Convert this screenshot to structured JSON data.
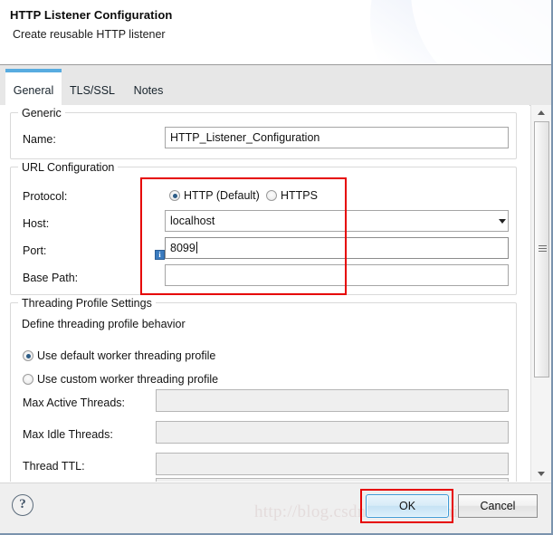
{
  "header": {
    "title": "HTTP Listener Configuration",
    "subtitle": "Create reusable HTTP listener"
  },
  "tabs": [
    {
      "label": "General",
      "active": true
    },
    {
      "label": "TLS/SSL",
      "active": false
    },
    {
      "label": "Notes",
      "active": false
    }
  ],
  "generic_group": {
    "legend": "Generic",
    "name_label": "Name:",
    "name_value": "HTTP_Listener_Configuration"
  },
  "url_group": {
    "legend": "URL Configuration",
    "protocol_label": "Protocol:",
    "protocol_options": [
      {
        "label": "HTTP (Default)",
        "selected": true
      },
      {
        "label": "HTTPS",
        "selected": false
      }
    ],
    "host_label": "Host:",
    "host_value": "localhost",
    "port_label": "Port:",
    "port_value": "8099",
    "port_info_icon": "info-icon",
    "base_path_label": "Base Path:",
    "base_path_value": ""
  },
  "threading_group": {
    "legend": "Threading Profile Settings",
    "description": "Define threading profile behavior",
    "profile_options": [
      {
        "label": "Use default worker threading profile",
        "selected": true
      },
      {
        "label": "Use custom worker threading profile",
        "selected": false
      }
    ],
    "fields": [
      {
        "label": "Max Active Threads:",
        "value": ""
      },
      {
        "label": "Max Idle Threads:",
        "value": ""
      },
      {
        "label": "Thread TTL:",
        "value": ""
      }
    ]
  },
  "scrollbar": {
    "up_icon": "scroll-up-arrow-icon",
    "down_icon": "scroll-down-arrow-icon"
  },
  "footer": {
    "help_icon": "question-mark-icon",
    "ok_label": "OK",
    "cancel_label": "Cancel",
    "watermark": "http://blog.csdn.net/darenshimida"
  },
  "annotations": {
    "accent_red": "#e60000",
    "accent_blue": "#58ace0"
  }
}
